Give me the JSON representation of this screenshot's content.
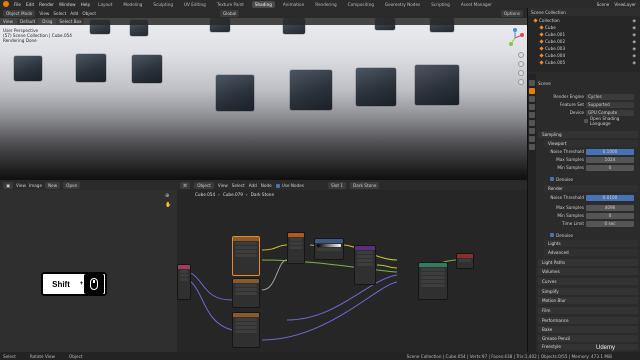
{
  "menu": {
    "items": [
      "File",
      "Edit",
      "Render",
      "Window",
      "Help"
    ],
    "workspaces": [
      "Layout",
      "Modeling",
      "Sculpting",
      "UV Editing",
      "Texture Paint",
      "Shading",
      "Animation",
      "Rendering",
      "Compositing",
      "Geometry Nodes",
      "Scripting",
      "Asset Manager"
    ],
    "active_workspace": "Shading",
    "scene": "Scene",
    "view_layer": "ViewLayer"
  },
  "viewport": {
    "mode": "Object Mode",
    "menu": [
      "View",
      "Select",
      "Add",
      "Object"
    ],
    "orientation": "Global",
    "options": "Options",
    "view_label": "View",
    "default": "Default",
    "drag": "Drag",
    "select_box": "Select Box",
    "info_line1": "User Perspective",
    "info_line2": "(57) Scene Collection | Cube.054",
    "info_line3": "Rendering Done"
  },
  "left_editor": {
    "menu": [
      "View",
      "Image"
    ],
    "new_label": "New",
    "open_label": "Open"
  },
  "overlay_hint": {
    "key": "Shift",
    "plus": "+"
  },
  "node_editor": {
    "type": "Object",
    "menu": [
      "View",
      "Select",
      "Add",
      "Node"
    ],
    "use_nodes": "Use Nodes",
    "slot": "Slot 1",
    "material": "Dark Stone",
    "breadcrumb": [
      "Cube.054",
      "Cube.079",
      "Dark Stone"
    ]
  },
  "outliner": {
    "title": "Scene Collection",
    "items": [
      "Collection",
      "Cube",
      "Cube.001",
      "Cube.002",
      "Cube.003",
      "Cube.004",
      "Cube.005"
    ]
  },
  "properties": {
    "scene": "Scene",
    "render_engine_label": "Render Engine",
    "render_engine": "Cycles",
    "feature_set_label": "Feature Set",
    "feature_set": "Supported",
    "device_label": "Device",
    "device": "GPU Compute",
    "osl_label": "Open Shading Language",
    "sampling": "Sampling",
    "viewport": "Viewport",
    "noise_threshold_label": "Noise Threshold",
    "noise_threshold_vp": "0.1000",
    "max_samples_label": "Max Samples",
    "max_samples_vp": "1024",
    "min_samples_label": "Min Samples",
    "min_samples_vp": "0",
    "denoise_label": "Denoise",
    "render": "Render",
    "noise_threshold_r": "0.0100",
    "max_samples_r": "4096",
    "min_samples_r": "0",
    "time_limit_label": "Time Limit",
    "time_limit": "0 sec",
    "denoise2_label": "Denoise",
    "lights": "Lights",
    "advanced": "Advanced",
    "sections": [
      "Light Paths",
      "Volumes",
      "Curves",
      "Simplify",
      "Motion Blur",
      "Film",
      "Performance",
      "Bake",
      "Grease Pencil",
      "Freestyle"
    ]
  },
  "status": {
    "select": "Select",
    "rotate": "Rotate View",
    "object": "Object",
    "stats": "Scene Collection | Cube.054 | Verts:97 | Faces:438 | Tris:1,402 | Objects:0/55 | Memory: 473.1 MiB"
  },
  "watermark": "Udemy",
  "colors": {
    "accent": "#e87d0d",
    "selection": "#4772b3",
    "active_node": "#e68a2e"
  }
}
